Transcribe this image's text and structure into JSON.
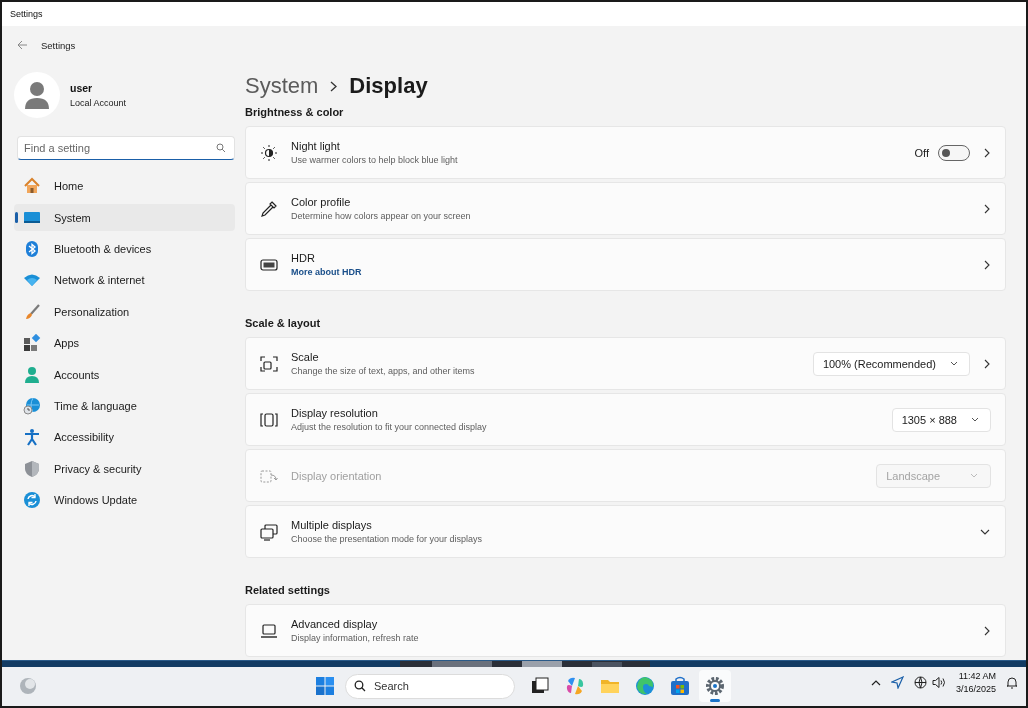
{
  "window": {
    "title": "Settings"
  },
  "nav": {
    "title": "Settings"
  },
  "account": {
    "name": "user",
    "type": "Local Account"
  },
  "search": {
    "placeholder": "Find a setting"
  },
  "sidebar": {
    "items": [
      {
        "label": "Home",
        "selected": false
      },
      {
        "label": "System",
        "selected": true
      },
      {
        "label": "Bluetooth & devices",
        "selected": false
      },
      {
        "label": "Network & internet",
        "selected": false
      },
      {
        "label": "Personalization",
        "selected": false
      },
      {
        "label": "Apps",
        "selected": false
      },
      {
        "label": "Accounts",
        "selected": false
      },
      {
        "label": "Time & language",
        "selected": false
      },
      {
        "label": "Accessibility",
        "selected": false
      },
      {
        "label": "Privacy & security",
        "selected": false
      },
      {
        "label": "Windows Update",
        "selected": false
      }
    ]
  },
  "breadcrumb": {
    "parent": "System",
    "current": "Display"
  },
  "sections": [
    {
      "title": "Brightness & color",
      "cards": [
        {
          "title": "Night light",
          "description": "Use warmer colors to help block blue light",
          "toggle": {
            "label": "Off",
            "on": false
          },
          "disabled": false,
          "kind": "navigate"
        },
        {
          "title": "Color profile",
          "description": "Determine how colors appear on your screen",
          "disabled": false,
          "kind": "navigate"
        },
        {
          "title": "HDR",
          "link": "More about HDR",
          "disabled": false,
          "kind": "navigate"
        }
      ]
    },
    {
      "title": "Scale & layout",
      "cards": [
        {
          "title": "Scale",
          "description": "Change the size of text, apps, and other items",
          "dropdown": "100% (Recommended)",
          "disabled": false,
          "kind": "navigate"
        },
        {
          "title": "Display resolution",
          "description": "Adjust the resolution to fit your connected display",
          "dropdown": "1305 × 888",
          "disabled": false,
          "kind": "plain"
        },
        {
          "title": "Display orientation",
          "dropdown": "Landscape",
          "disabled": true,
          "kind": "plain"
        },
        {
          "title": "Multiple displays",
          "description": "Choose the presentation mode for your displays",
          "disabled": false,
          "kind": "expand"
        }
      ]
    },
    {
      "title": "Related settings",
      "cards": [
        {
          "title": "Advanced display",
          "description": "Display information, refresh rate",
          "disabled": false,
          "kind": "navigate"
        }
      ]
    }
  ],
  "taskbar": {
    "search": {
      "placeholder": "Search"
    },
    "apps": [
      {
        "selected": false
      },
      {
        "selected": false
      },
      {
        "selected": false
      },
      {
        "selected": false
      },
      {
        "selected": false
      },
      {
        "selected": true
      }
    ],
    "clock": {
      "time": "11:42 AM",
      "date": "3/16/2025"
    }
  }
}
